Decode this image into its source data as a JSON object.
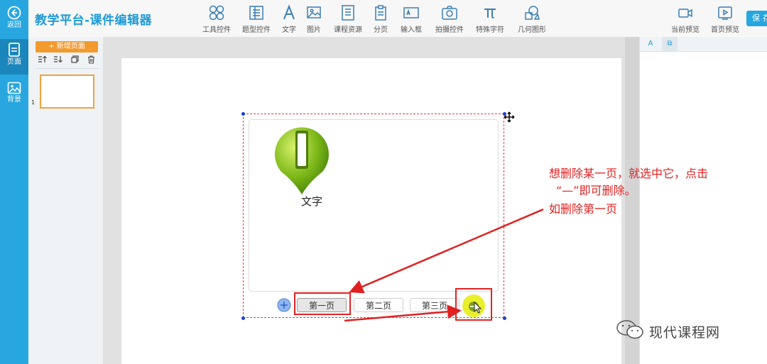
{
  "app": {
    "title": "教学平台-课件编辑器"
  },
  "rail": {
    "back": "返回",
    "page": "页面",
    "background": "背景"
  },
  "toolbar": {
    "tools": [
      {
        "label": "工具控件",
        "icon": "tool-control-icon"
      },
      {
        "label": "题型控件",
        "icon": "question-type-icon"
      },
      {
        "label": "文字",
        "icon": "text-icon"
      },
      {
        "label": "图片",
        "icon": "image-icon"
      },
      {
        "label": "课程资源",
        "icon": "course-resource-icon"
      },
      {
        "label": "分页",
        "icon": "pagination-icon"
      },
      {
        "label": "输入框",
        "icon": "input-box-icon"
      },
      {
        "label": "拍摄控件",
        "icon": "camera-icon"
      },
      {
        "label": "特殊字符",
        "icon": "pi-icon"
      },
      {
        "label": "几何图形",
        "icon": "geometry-icon"
      }
    ],
    "preview_current": "当前预览",
    "preview_first": "首页预览",
    "save": "保存"
  },
  "page_panel": {
    "add_page": "+ 新增页面",
    "thumb_number": "1"
  },
  "props": {
    "tab_text": "A",
    "tab_copy": "⧉"
  },
  "widget": {
    "pin_label": "文字",
    "pin_glyph": "I",
    "tabs": [
      "第一页",
      "第二页",
      "第三页"
    ]
  },
  "annotation": {
    "line1": "想删除某一页，就选中它，点击",
    "line2": "“—”即可删除。",
    "line3": "如删除第一页"
  },
  "watermark": {
    "text": "现代课程网"
  },
  "colors": {
    "accent": "#27a6e0",
    "orange": "#f39a2d",
    "annotation_red": "#e02020"
  }
}
